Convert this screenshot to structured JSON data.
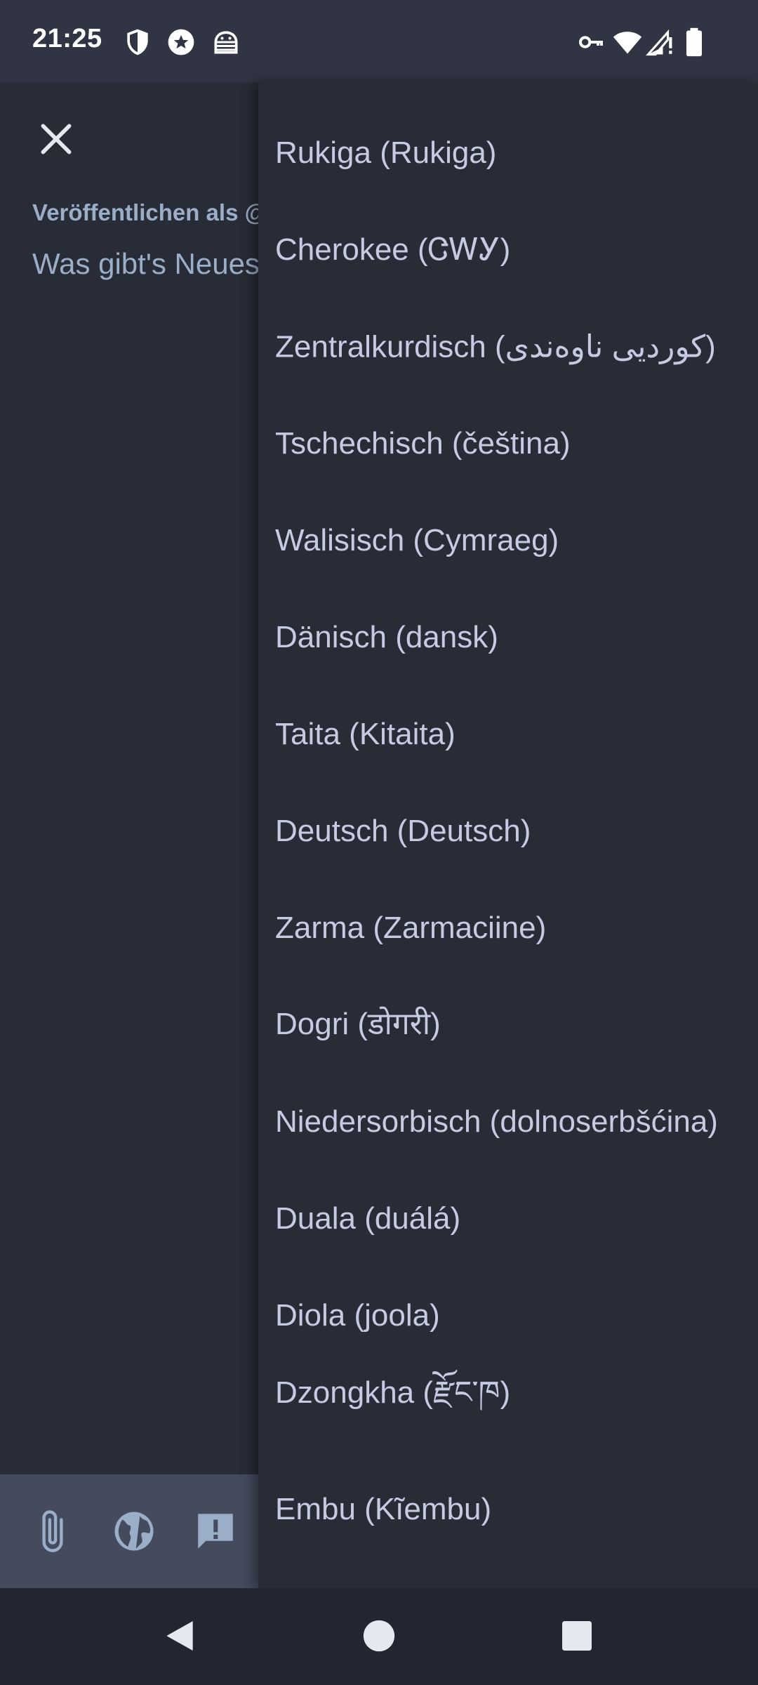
{
  "status_bar": {
    "time": "21:25",
    "left_icons": [
      "shield-icon",
      "star-badge-icon",
      "android-debug-icon"
    ],
    "right_icons": [
      "vpn-key-icon",
      "wifi-icon",
      "signal-icon",
      "battery-icon"
    ]
  },
  "compose": {
    "publish_as_label": "Veröffentlichen als @",
    "input_placeholder": "Was gibt's Neues?"
  },
  "toolbar": {
    "buttons": [
      "attach-icon",
      "globe-icon",
      "content-warning-icon"
    ]
  },
  "language_menu": {
    "items": [
      {
        "label": "Rukiga (Rukiga)"
      },
      {
        "label": "Cherokee (ᏣᎳᎩ)"
      },
      {
        "label": "Zentralkurdisch (کوردیی ناوەندی)"
      },
      {
        "label": "Tschechisch (čeština)"
      },
      {
        "label": "Walisisch (Cymraeg)"
      },
      {
        "label": "Dänisch (dansk)"
      },
      {
        "label": "Taita (Kitaita)"
      },
      {
        "label": "Deutsch (Deutsch)"
      },
      {
        "label": "Zarma (Zarmaciine)"
      },
      {
        "label": "Dogri (डोगरी)"
      },
      {
        "label": "Niedersorbisch (dolnoserbšćina)"
      },
      {
        "label": "Duala (duálá)"
      },
      {
        "label": "Diola (joola)"
      },
      {
        "label": "Dzongkha (རྫོང་ཁ)"
      },
      {
        "label": "Embu (Kĩembu)"
      }
    ]
  },
  "nav_bar": {
    "buttons": [
      "back-icon",
      "home-icon",
      "recents-icon"
    ]
  }
}
